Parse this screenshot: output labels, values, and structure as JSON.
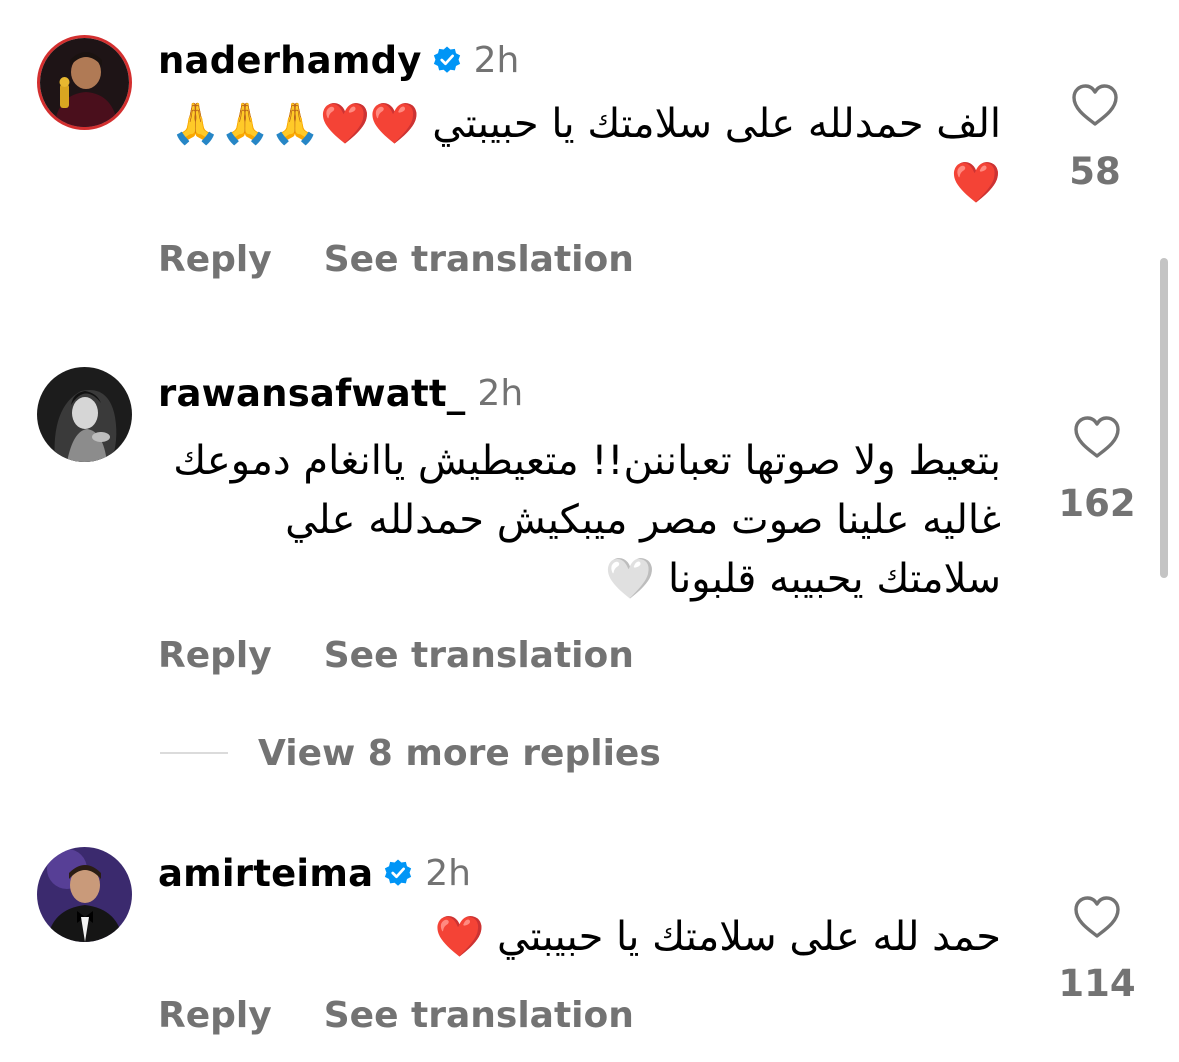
{
  "colors": {
    "username": "#000000",
    "secondary_text": "#737373",
    "verified_badge": "#0095f6",
    "divider": "#dbdbdb",
    "scrollbar": "#c4c4c4"
  },
  "comments": [
    {
      "username": "naderhamdy",
      "verified": true,
      "time": "2h",
      "text": "الف حمدلله على سلامتك يا حبيبتي ❤️❤️🙏🙏🙏❤️",
      "likes": "58",
      "reply_label": "Reply",
      "translate_label": "See translation",
      "avatar_icon": "avatar-man-holding-trophy"
    },
    {
      "username": "rawansafwatt_",
      "verified": false,
      "time": "2h",
      "text": "بتعيط ولا صوتها تعباننن!! متعيطيش ياانغام دموعك غاليه علينا صوت مصر ميبكيش حمدلله علي سلامتك يحبيبه قلبونا 🤍",
      "likes": "162",
      "reply_label": "Reply",
      "translate_label": "See translation",
      "avatar_icon": "avatar-woman-black-and-white"
    },
    {
      "username": "amirteima",
      "verified": true,
      "time": "2h",
      "text": "حمد لله على سلامتك يا حبيبتي ❤️",
      "likes": "114",
      "reply_label": "Reply",
      "translate_label": "See translation",
      "avatar_icon": "avatar-man-bow-tie"
    }
  ],
  "view_more": {
    "label": "View 8 more replies"
  },
  "icons": {
    "like": "heart-outline-icon",
    "verified": "verified-badge-icon"
  }
}
